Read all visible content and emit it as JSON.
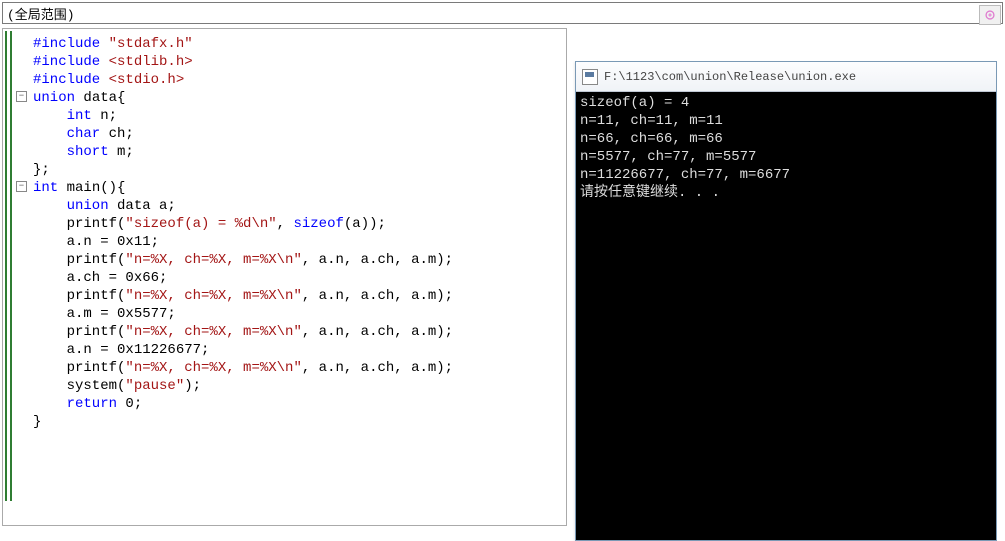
{
  "dropdown": {
    "label": "(全局范围)"
  },
  "console": {
    "title": "F:\\1123\\com\\union\\Release\\union.exe",
    "lines": [
      "sizeof(a) = 4",
      "n=11, ch=11, m=11",
      "n=66, ch=66, m=66",
      "n=5577, ch=77, m=5577",
      "n=11226677, ch=77, m=6677",
      "请按任意键继续. . ."
    ]
  },
  "code": {
    "l1a": "#include",
    "l1b": " \"stdafx.h\"",
    "l2a": "#include",
    "l2b": " <stdlib.h>",
    "l3a": "#include",
    "l3b": " <stdio.h>",
    "l4a": "union",
    "l4b": " data{",
    "l5a": "    int",
    "l5b": " n;",
    "l6a": "    char",
    "l6b": " ch;",
    "l7a": "    short",
    "l7b": " m;",
    "l8": "};",
    "l9a": "int",
    "l9b": " main(){",
    "l10a": "    union",
    "l10b": " data a;",
    "l11a": "    printf(",
    "l11b": "\"sizeof(a) = %d\\n\"",
    "l11c": ", ",
    "l11d": "sizeof",
    "l11e": "(a));",
    "l12": "    a.n = 0x11;",
    "l13a": "    printf(",
    "l13b": "\"n=%X, ch=%X, m=%X\\n\"",
    "l13c": ", a.n, a.ch, a.m);",
    "l14": "    a.ch = 0x66;",
    "l15a": "    printf(",
    "l15b": "\"n=%X, ch=%X, m=%X\\n\"",
    "l15c": ", a.n, a.ch, a.m);",
    "l16": "    a.m = 0x5577;",
    "l17a": "    printf(",
    "l17b": "\"n=%X, ch=%X, m=%X\\n\"",
    "l17c": ", a.n, a.ch, a.m);",
    "l18": "    a.n = 0x11226677;",
    "l19a": "    printf(",
    "l19b": "\"n=%X, ch=%X, m=%X\\n\"",
    "l19c": ", a.n, a.ch, a.m);",
    "l20a": "    system(",
    "l20b": "\"pause\"",
    "l20c": ");",
    "l21a": "    return",
    "l21b": " 0;",
    "l22": "}"
  }
}
